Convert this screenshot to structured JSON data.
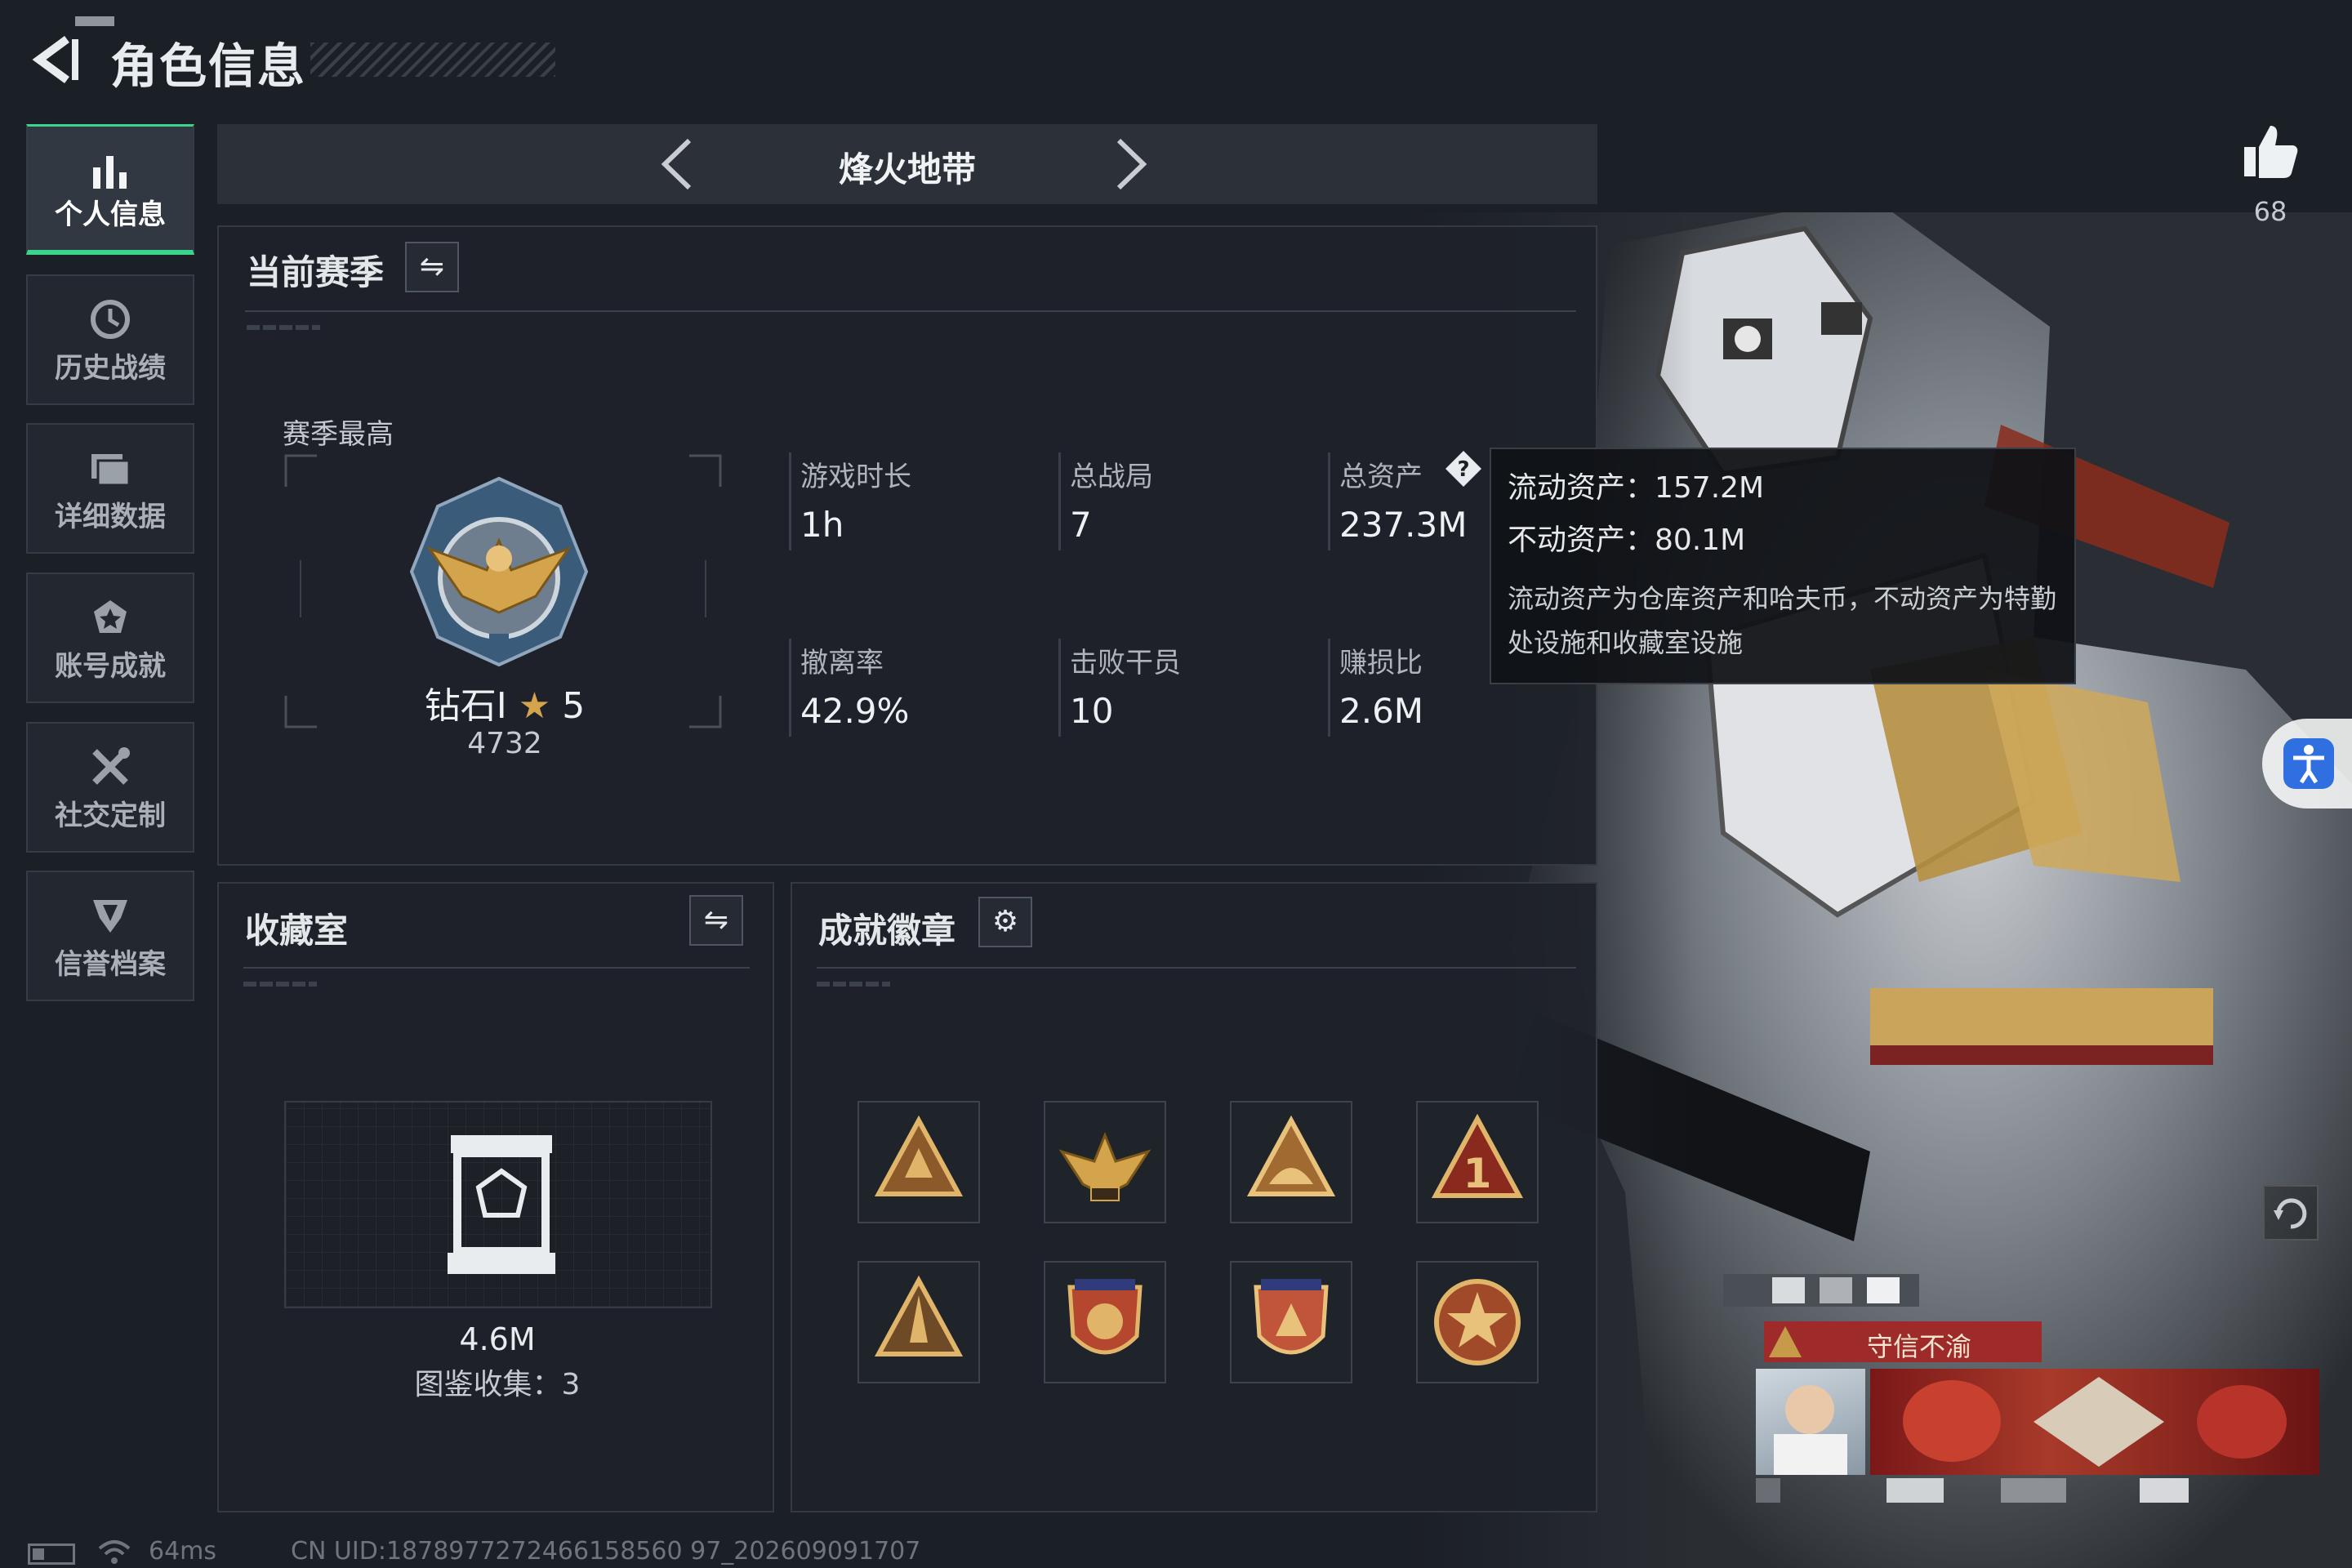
{
  "header": {
    "title": "角色信息"
  },
  "nav": {
    "items": [
      {
        "label": "个人信息",
        "icon": "bar-chart-icon",
        "active": true
      },
      {
        "label": "历史战绩",
        "icon": "history-clock-icon",
        "active": false
      },
      {
        "label": "详细数据",
        "icon": "folder-stack-icon",
        "active": false
      },
      {
        "label": "账号成就",
        "icon": "achievement-star-icon",
        "active": false
      },
      {
        "label": "社交定制",
        "icon": "wrench-cross-icon",
        "active": false
      },
      {
        "label": "信誉档案",
        "icon": "credit-shield-icon",
        "active": false
      }
    ]
  },
  "mode": {
    "name": "烽火地带"
  },
  "season": {
    "title": "当前赛季",
    "best_label": "赛季最高",
    "rank_name": "钻石Ⅰ",
    "rank_stars": "5",
    "rank_score": "4732",
    "stats": [
      {
        "label": "游戏时长",
        "value": "1h"
      },
      {
        "label": "总战局",
        "value": "7"
      },
      {
        "label": "总资产",
        "value": "237.3M"
      },
      {
        "label": "撤离率",
        "value": "42.9%"
      },
      {
        "label": "击败干员",
        "value": "10"
      },
      {
        "label": "赚损比",
        "value": "2.6M"
      }
    ]
  },
  "tooltip": {
    "liquid": "流动资产：157.2M",
    "fixed": "不动资产：80.1M",
    "note": "流动资产为仓库资产和哈夫币，不动资产为特勤处设施和收藏室设施"
  },
  "collection": {
    "title": "收藏室",
    "value": "4.6M",
    "count_label": "图鉴收集：3"
  },
  "badges": {
    "title": "成就徽章",
    "items": [
      "triangle-badge-1",
      "eagle-badge",
      "triangle-badge-2",
      "number-one-badge",
      "rocket-badge",
      "crest-badge-1",
      "crest-badge-2",
      "star-medal-badge"
    ]
  },
  "like": {
    "count": "68"
  },
  "player_card": {
    "tag": "守信不渝"
  },
  "footer": {
    "ping": "64ms",
    "uid": "CN UID:1878977272466158560 97_202609091707"
  },
  "colors": {
    "accent": "#3ad58d",
    "panel": "#1e2229",
    "bg": "#1b1f26",
    "gold": "#c79a4a",
    "tag_red": "#9e2a2a"
  }
}
